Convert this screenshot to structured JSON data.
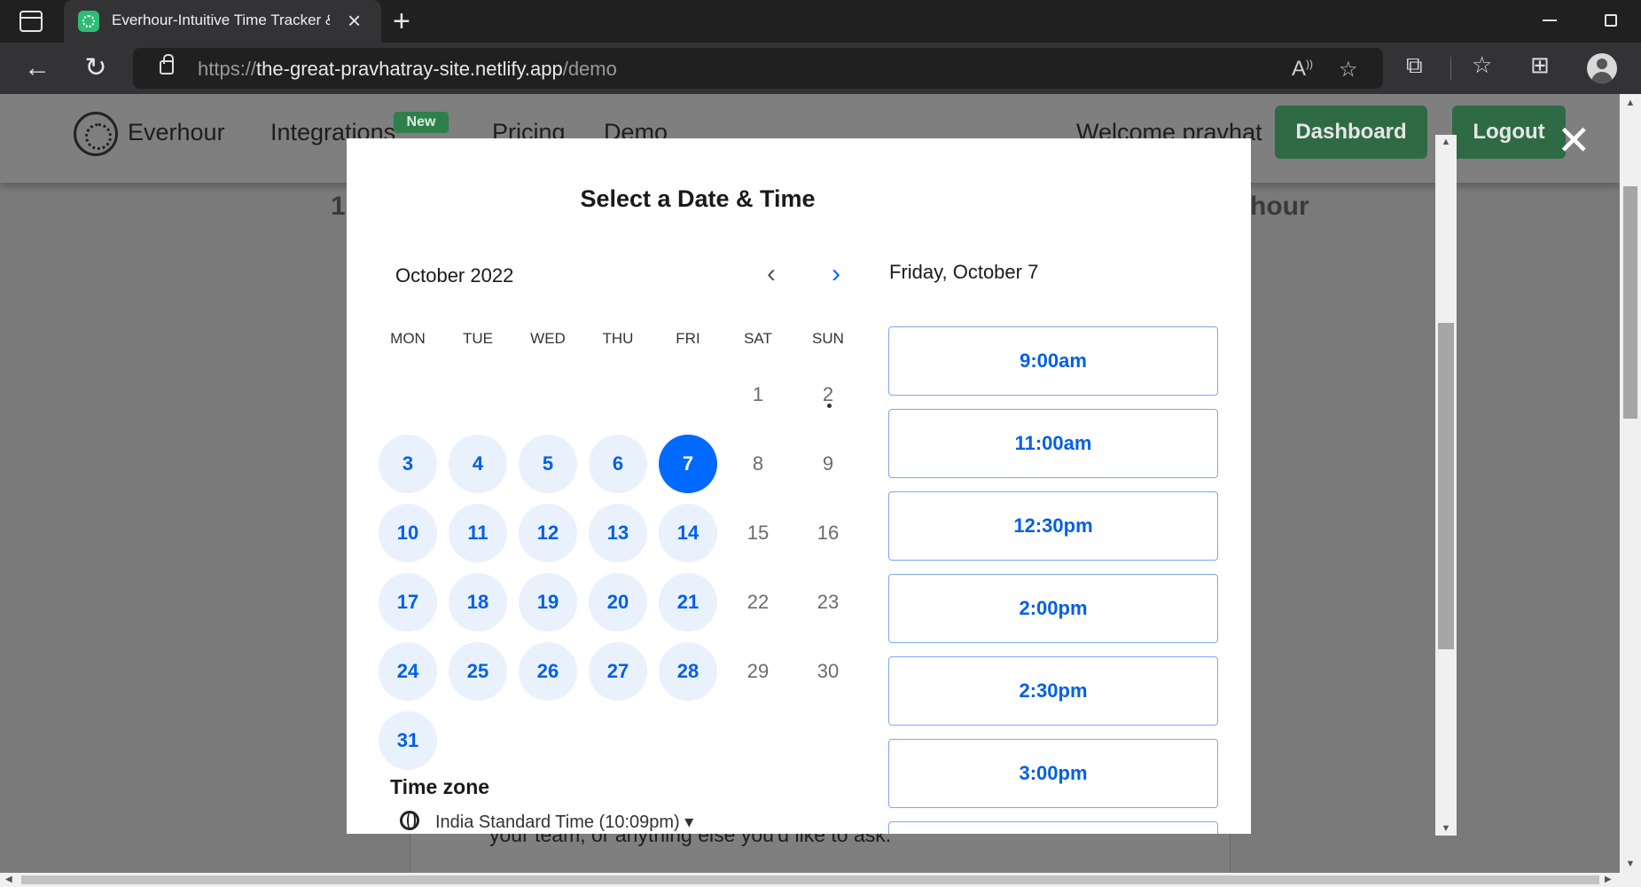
{
  "browser": {
    "tab_title": "Everhour-Intuitive Time Tracker &",
    "url_scheme": "https://",
    "url_host": "the-great-pravhatray-site.netlify.app",
    "url_path": "/demo"
  },
  "site": {
    "logo_text": "Everhour",
    "nav": {
      "integrations": "Integrations",
      "new_badge": "New",
      "pricing": "Pricing",
      "demo": "Demo",
      "welcome": "Welcome pravhat"
    },
    "dashboard_button": "Dashboard",
    "logout_button": "Logout",
    "close_glyph": "✕",
    "bg_heading_left": "1",
    "bg_heading_right": "hour",
    "bg_text": "your team, or anything else you'd like to ask."
  },
  "scheduler": {
    "title": "Select a Date & Time",
    "month": "October 2022",
    "weekdays": [
      "MON",
      "TUE",
      "WED",
      "THU",
      "FRI",
      "SAT",
      "SUN"
    ],
    "days": [
      {
        "n": "1",
        "state": "off"
      },
      {
        "n": "2",
        "state": "off"
      },
      {
        "n": "3",
        "state": "avail"
      },
      {
        "n": "4",
        "state": "avail"
      },
      {
        "n": "5",
        "state": "avail"
      },
      {
        "n": "6",
        "state": "avail"
      },
      {
        "n": "7",
        "state": "selected"
      },
      {
        "n": "8",
        "state": "off"
      },
      {
        "n": "9",
        "state": "off"
      },
      {
        "n": "10",
        "state": "avail"
      },
      {
        "n": "11",
        "state": "avail"
      },
      {
        "n": "12",
        "state": "avail"
      },
      {
        "n": "13",
        "state": "avail"
      },
      {
        "n": "14",
        "state": "avail"
      },
      {
        "n": "15",
        "state": "off"
      },
      {
        "n": "16",
        "state": "off"
      },
      {
        "n": "17",
        "state": "avail"
      },
      {
        "n": "18",
        "state": "avail"
      },
      {
        "n": "19",
        "state": "avail"
      },
      {
        "n": "20",
        "state": "avail"
      },
      {
        "n": "21",
        "state": "avail"
      },
      {
        "n": "22",
        "state": "off"
      },
      {
        "n": "23",
        "state": "off"
      },
      {
        "n": "24",
        "state": "avail"
      },
      {
        "n": "25",
        "state": "avail"
      },
      {
        "n": "26",
        "state": "avail"
      },
      {
        "n": "27",
        "state": "avail"
      },
      {
        "n": "28",
        "state": "avail"
      },
      {
        "n": "29",
        "state": "off"
      },
      {
        "n": "30",
        "state": "off"
      },
      {
        "n": "31",
        "state": "avail"
      }
    ],
    "first_weekday_index": 5,
    "timezone_label": "Time zone",
    "timezone_value": "India Standard Time (10:09pm) ▾",
    "selected_day_heading": "Friday, October 7",
    "time_slots": [
      "9:00am",
      "11:00am",
      "12:30pm",
      "2:00pm",
      "2:30pm",
      "3:00pm",
      ""
    ]
  },
  "colors": {
    "accent": "#0069ff",
    "available_bg": "#e9f1fd",
    "header_button": "#2e6b45"
  }
}
